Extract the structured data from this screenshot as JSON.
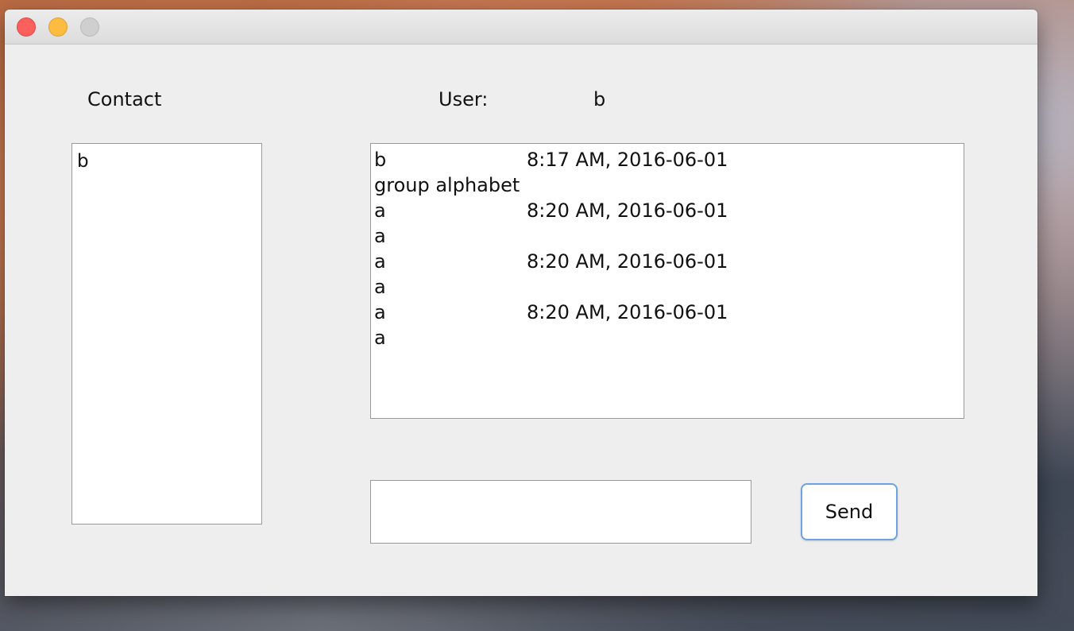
{
  "desktop": {
    "wallpaper": "macOS El Capitan"
  },
  "window": {
    "traffic_lights": {
      "close_color": "#fc605c",
      "minimize_color": "#fdbc40",
      "zoom_color": "#cfcfcf"
    },
    "contact_label": "Contact",
    "user_label": "User:",
    "user_value": "b",
    "contacts": [
      "b"
    ],
    "messages": [
      {
        "sender": "b",
        "time": "8:17 AM, 2016-06-01",
        "text": "group alphabet"
      },
      {
        "sender": "a",
        "time": "8:20 AM, 2016-06-01",
        "text": "a"
      },
      {
        "sender": "a",
        "time": "8:20 AM, 2016-06-01",
        "text": "a"
      },
      {
        "sender": "a",
        "time": "8:20 AM, 2016-06-01",
        "text": "a"
      }
    ],
    "input": {
      "value": "",
      "placeholder": ""
    },
    "send_label": "Send",
    "send_border_color": "#6fa3e0"
  }
}
